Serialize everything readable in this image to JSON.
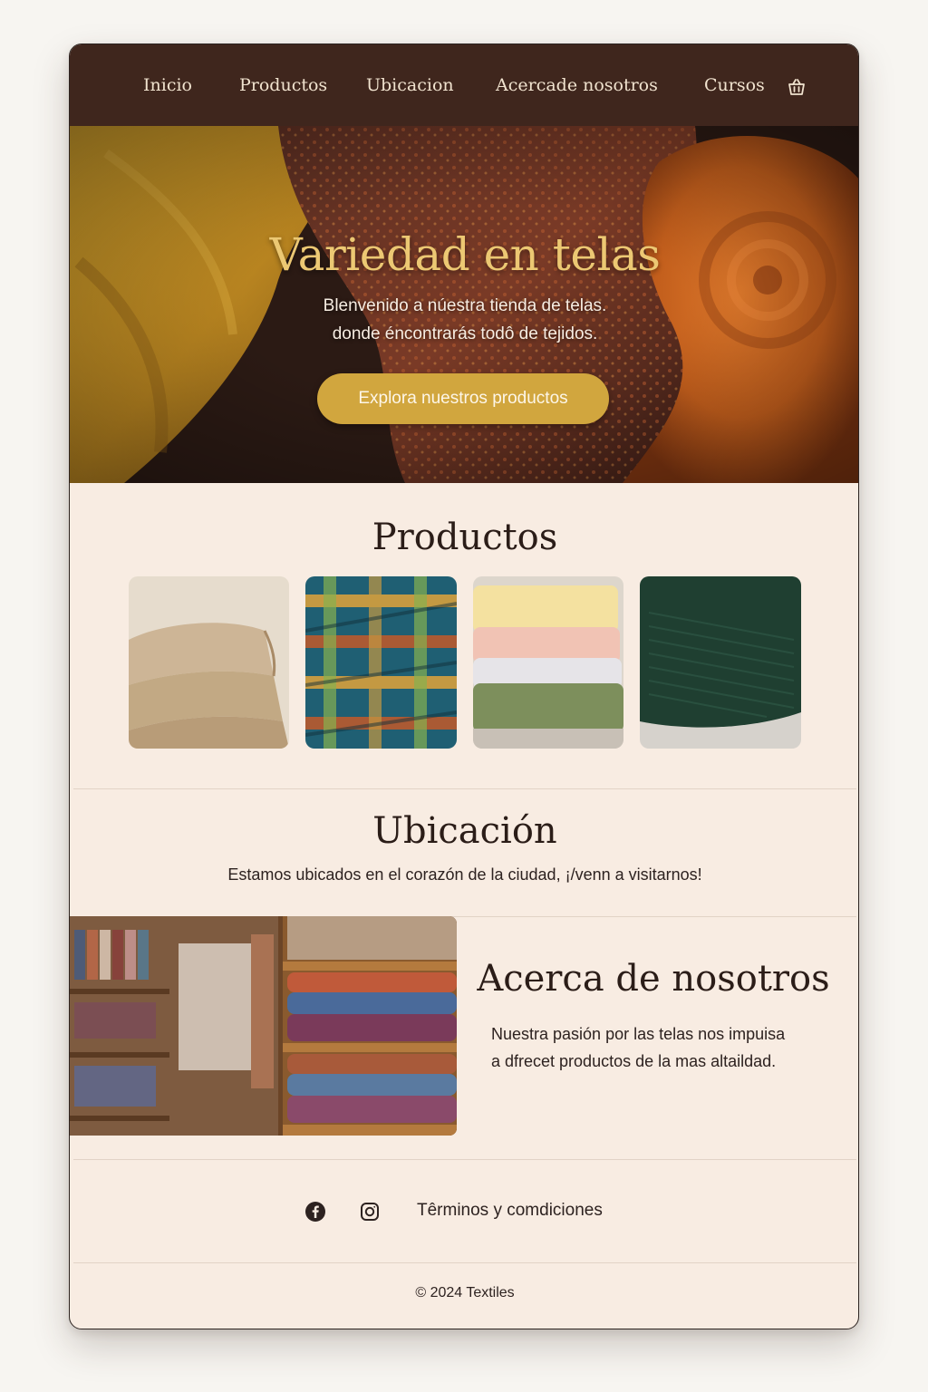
{
  "nav": {
    "items": [
      {
        "label": "Inicio"
      },
      {
        "label": "Productos"
      },
      {
        "label": "Ubicacion"
      },
      {
        "label": "Acercade nosotros"
      },
      {
        "label": "Cursos"
      }
    ],
    "cart_icon": "basket-icon"
  },
  "hero": {
    "title": "Variedad en telas",
    "subtitle_line1": "Blenvenido a núestra tienda de telas.",
    "subtitle_line2": "donde éncontrarás todô de tejidos.",
    "cta_label": "Explora nuestros productos"
  },
  "products": {
    "title": "Productos",
    "items": [
      {
        "image": "beige-folded-fabric"
      },
      {
        "image": "plaid-fabric"
      },
      {
        "image": "pastel-stacked-fabrics"
      },
      {
        "image": "green-corduroy-fabric"
      }
    ]
  },
  "location": {
    "title": "Ubicación",
    "text": "Estamos ubicados en el corazón de la ciudad, ¡/venn a visitarnos!"
  },
  "about": {
    "title": "Acerca de nosotros",
    "line1": "Nuestra pasión por las telas nos impuisa",
    "line2": "a dfrecet productos de la mas altaildad."
  },
  "footer": {
    "social_icons": [
      "facebook-icon",
      "instagram-icon"
    ],
    "terms_label": "Têrminos y comdiciones",
    "copyright": "© 2024 Textiles"
  },
  "colors": {
    "nav_bg": "#3f261d",
    "nav_text": "#f1e3cf",
    "accent_gold": "#d1a63e",
    "hero_title": "#ecc873",
    "page_bg": "#f8ece2",
    "text_dark": "#2b1d18"
  }
}
